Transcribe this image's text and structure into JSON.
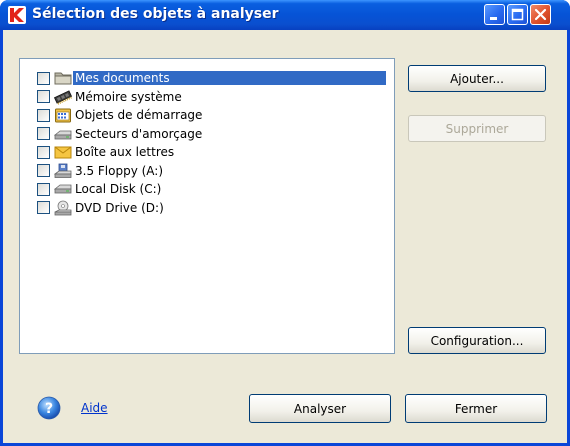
{
  "window": {
    "title": "Sélection des objets à analyser",
    "colors": {
      "titlebar": "#0653d6",
      "selection": "#316ac5",
      "client": "#ece9d8",
      "link": "#0033cc"
    }
  },
  "list": {
    "items": [
      {
        "label": "Mes documents",
        "icon": "folder-icon",
        "checked": false,
        "selected": true
      },
      {
        "label": "Mémoire système",
        "icon": "memory-chip-icon",
        "checked": false,
        "selected": false
      },
      {
        "label": "Objets de démarrage",
        "icon": "startup-objects-icon",
        "checked": false,
        "selected": false
      },
      {
        "label": "Secteurs d'amorçage",
        "icon": "boot-sector-disk-icon",
        "checked": false,
        "selected": false
      },
      {
        "label": "Boîte aux lettres",
        "icon": "mailbox-envelope-icon",
        "checked": false,
        "selected": false
      },
      {
        "label": "3.5 Floppy (A:)",
        "icon": "floppy-drive-icon",
        "checked": false,
        "selected": false
      },
      {
        "label": "Local Disk (C:)",
        "icon": "hard-disk-icon",
        "checked": false,
        "selected": false
      },
      {
        "label": "DVD Drive (D:)",
        "icon": "dvd-drive-icon",
        "checked": false,
        "selected": false
      }
    ]
  },
  "buttons": {
    "add": "Ajouter...",
    "remove": "Supprimer",
    "configuration": "Configuration...",
    "scan": "Analyser",
    "close": "Fermer"
  },
  "help": {
    "label": "Aide",
    "icon": "help-icon"
  }
}
